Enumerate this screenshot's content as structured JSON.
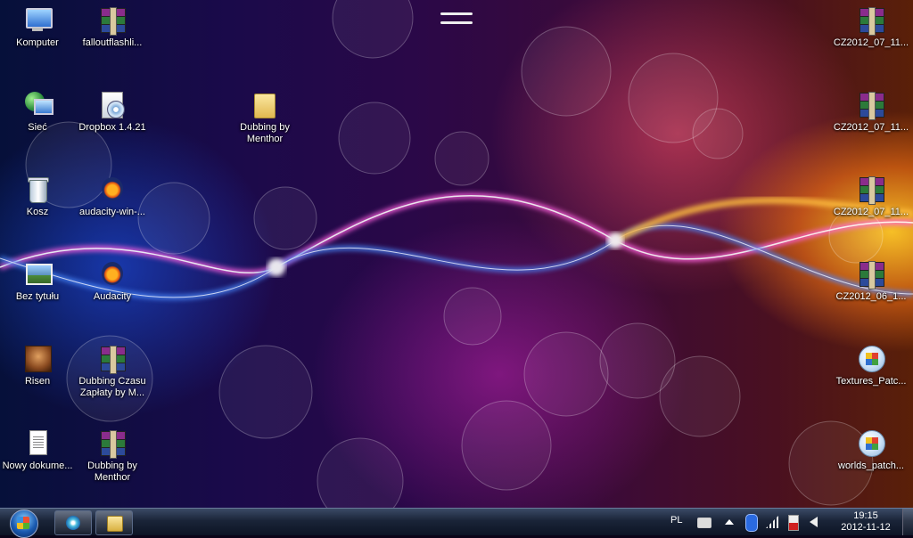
{
  "desktop": {
    "left_column": [
      {
        "label": "Komputer",
        "icon": "computer-icon"
      },
      {
        "label": "Sieć",
        "icon": "network-icon"
      },
      {
        "label": "Kosz",
        "icon": "recycle-bin-icon"
      },
      {
        "label": "Bez tytułu",
        "icon": "image-icon"
      },
      {
        "label": "Risen",
        "icon": "risen-game-icon"
      },
      {
        "label": "Nowy dokume...",
        "icon": "text-document-icon"
      }
    ],
    "second_column": [
      {
        "label": "falloutflashli...",
        "icon": "winrar-archive-icon"
      },
      {
        "label": "Dropbox 1.4.21",
        "icon": "installer-icon"
      },
      {
        "label": "audacity-win-...",
        "icon": "audacity-icon"
      },
      {
        "label": "Audacity",
        "icon": "audacity-icon"
      },
      {
        "label": "Dubbing Czasu Zapłaty by M...",
        "icon": "winrar-archive-icon"
      },
      {
        "label": "Dubbing by Menthor",
        "icon": "winrar-archive-icon"
      }
    ],
    "folder": {
      "label": "Dubbing by Menthor",
      "icon": "folder-icon"
    },
    "right_column": [
      {
        "label": "CZ2012_07_11...",
        "icon": "winrar-archive-icon"
      },
      {
        "label": "CZ2012_07_11...",
        "icon": "winrar-archive-icon"
      },
      {
        "label": "CZ2012_07_11...",
        "icon": "winrar-archive-icon"
      },
      {
        "label": "CZ2012_06_1...",
        "icon": "winrar-archive-icon"
      },
      {
        "label": "Textures_Patc...",
        "icon": "setup-patch-icon"
      },
      {
        "label": "worlds_patch...",
        "icon": "setup-patch-icon"
      }
    ]
  },
  "taskbar": {
    "pinned": [
      {
        "name": "Windows Media Player",
        "icon": "media-player-icon"
      },
      {
        "name": "Windows Explorer",
        "icon": "explorer-folder-icon"
      }
    ],
    "tray": {
      "language": "PL",
      "time": "19:15",
      "date": "2012-11-12"
    }
  },
  "colors": {
    "taskbar": "#1a2438",
    "wave_blue": "#2a6aff",
    "wave_pink": "#ff40d0",
    "wave_orange": "#ffb020"
  }
}
